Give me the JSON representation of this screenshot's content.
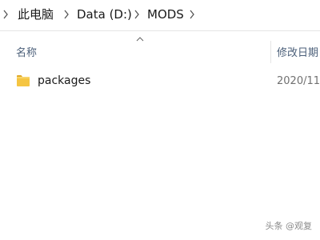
{
  "breadcrumb": {
    "items": [
      {
        "label": "此电脑"
      },
      {
        "label": "Data (D:)"
      },
      {
        "label": "MODS"
      }
    ]
  },
  "columns": {
    "name": "名称",
    "date_modified": "修改日期"
  },
  "files": [
    {
      "name": "packages",
      "type": "folder",
      "date": "2020/11"
    }
  ],
  "watermark": "头条 @观复",
  "colors": {
    "folder": "#f5c542",
    "header_text": "#4c607a",
    "divider": "#e5e5e5"
  }
}
